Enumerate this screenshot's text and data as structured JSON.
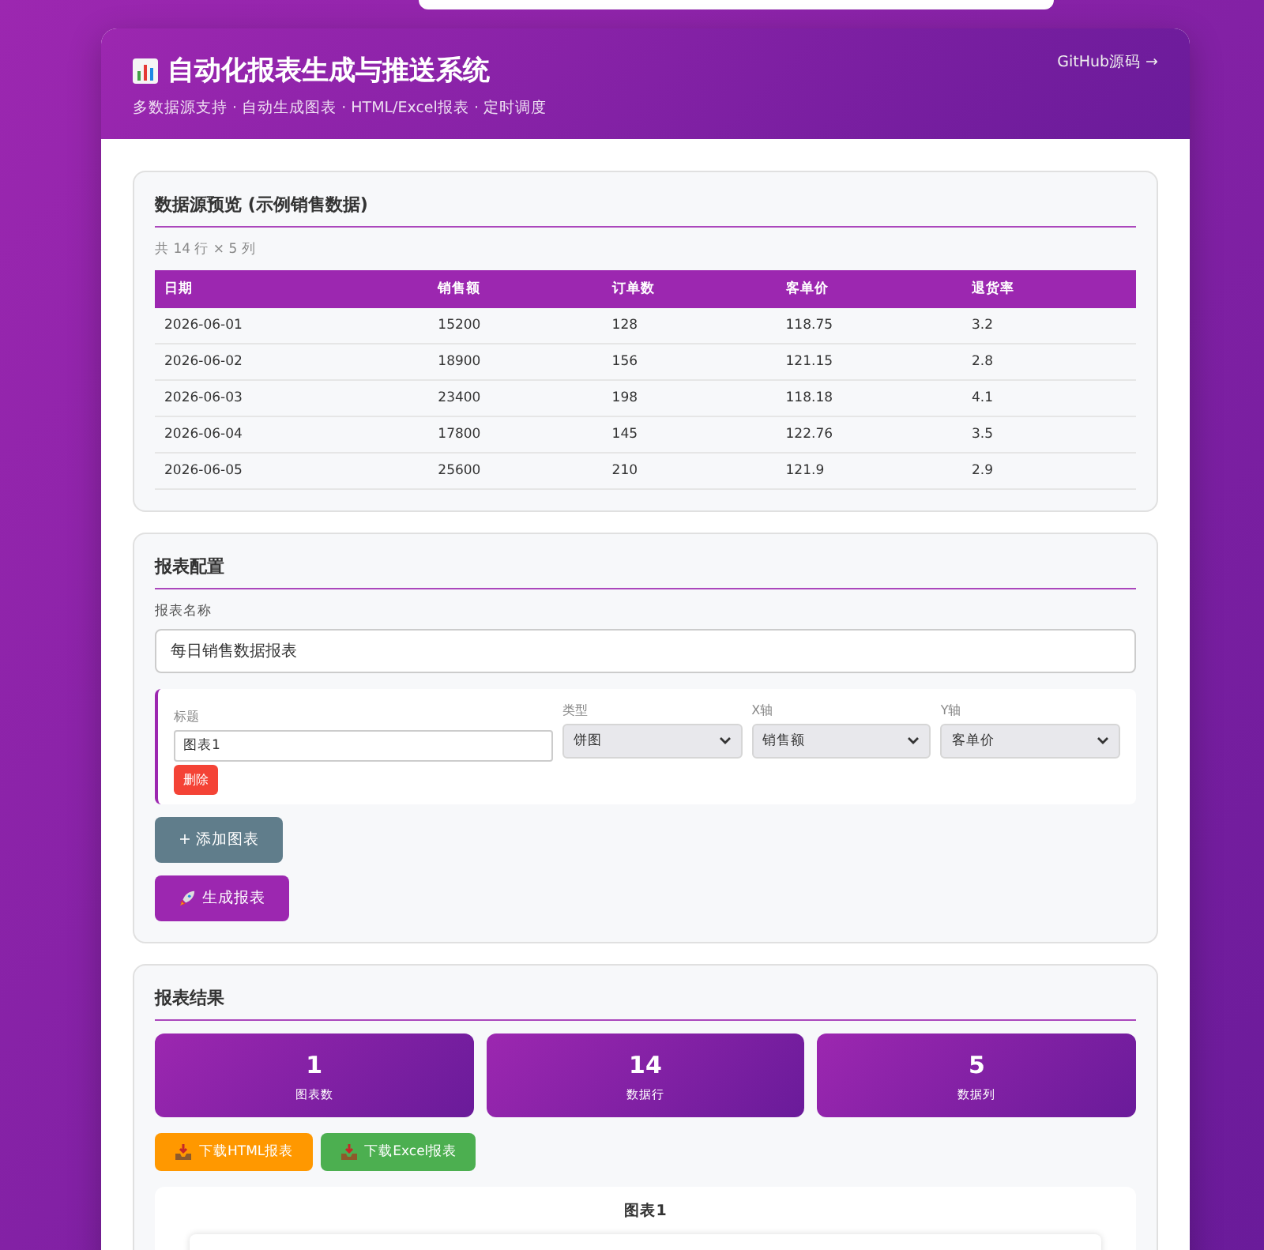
{
  "header": {
    "title": "自动化报表生成与推送系统",
    "subtitle": "多数据源支持 · 自动生成图表 · HTML/Excel报表 · 定时调度",
    "link": "GitHub源码 →"
  },
  "preview": {
    "title": "数据源预览 (示例销售数据)",
    "summary": "共 14 行 × 5 列",
    "columns": [
      "日期",
      "销售额",
      "订单数",
      "客单价",
      "退货率"
    ],
    "rows": [
      [
        "2026-06-01",
        "15200",
        "128",
        "118.75",
        "3.2"
      ],
      [
        "2026-06-02",
        "18900",
        "156",
        "121.15",
        "2.8"
      ],
      [
        "2026-06-03",
        "23400",
        "198",
        "118.18",
        "4.1"
      ],
      [
        "2026-06-04",
        "17800",
        "145",
        "122.76",
        "3.5"
      ],
      [
        "2026-06-05",
        "25600",
        "210",
        "121.9",
        "2.9"
      ]
    ]
  },
  "config": {
    "title": "报表配置",
    "name_label": "报表名称",
    "name_value": "每日销售数据报表",
    "charts": [
      {
        "title_label": "标题",
        "title_value": "图表1",
        "type_label": "类型",
        "type_value": "饼图",
        "x_label": "X轴",
        "x_value": "销售额",
        "y_label": "Y轴",
        "y_value": "客单价",
        "delete": "删除"
      }
    ],
    "add_button": "+ 添加图表",
    "generate_button": "生成报表"
  },
  "result": {
    "title": "报表结果",
    "stats": [
      {
        "value": "1",
        "label": "图表数"
      },
      {
        "value": "14",
        "label": "数据行"
      },
      {
        "value": "5",
        "label": "数据列"
      }
    ],
    "downloads": [
      {
        "kind": "html",
        "label": "下载HTML报表"
      },
      {
        "kind": "excel",
        "label": "下载Excel报表"
      }
    ],
    "chart_title": "图表1"
  }
}
